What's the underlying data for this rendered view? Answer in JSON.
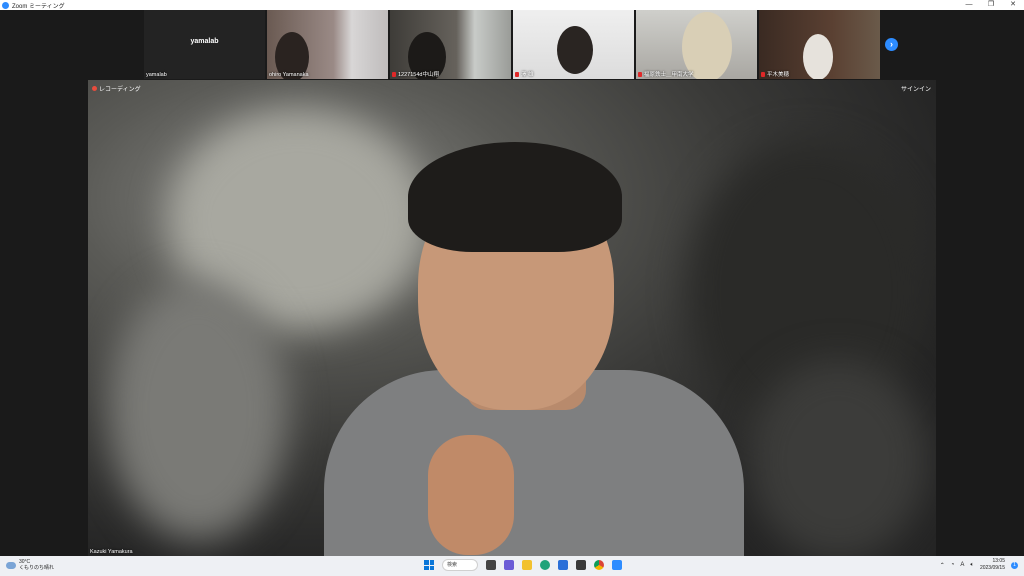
{
  "window": {
    "title": "Zoom ミーティング"
  },
  "gallery": {
    "tiles": [
      {
        "name": "yamalab",
        "center_label": "yamalab"
      },
      {
        "name": "ohiro Yamanaka"
      },
      {
        "name": "1227154d中山翔"
      },
      {
        "name": "澤 雄"
      },
      {
        "name": "福原鉄士＿甲南大学"
      },
      {
        "name": "平木美穂"
      }
    ]
  },
  "main_video": {
    "recording_label": "レコーディング",
    "sign_in_label": "サインイン",
    "speaker_name": "Kazuki Yamakura"
  },
  "taskbar": {
    "weather_temp": "30°C",
    "weather_desc": "くもりのち晴れ",
    "search_label": "検索",
    "time": "13:05",
    "date": "2023/09/15",
    "notification_count": "1"
  },
  "colors": {
    "zoom_blue": "#2d8cff",
    "rec_red": "#e84c3d"
  }
}
